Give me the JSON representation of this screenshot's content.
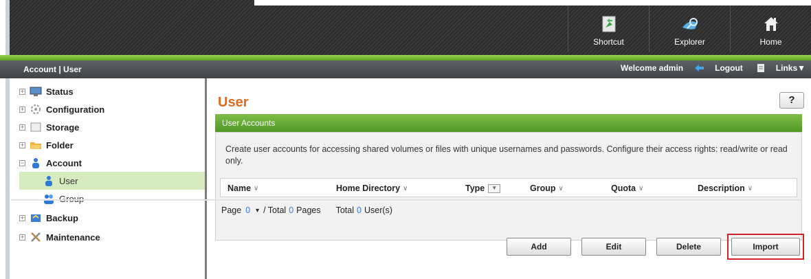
{
  "header": {
    "nav": [
      {
        "label": "Shortcut",
        "icon": "shortcut-icon"
      },
      {
        "label": "Explorer",
        "icon": "explorer-icon"
      },
      {
        "label": "Home",
        "icon": "home-icon"
      }
    ]
  },
  "subbar": {
    "breadcrumb": "Account | User",
    "welcome": "Welcome admin",
    "logout": "Logout",
    "links": "Links▼"
  },
  "sidebar": {
    "items": [
      {
        "label": "Status",
        "icon": "monitor-icon",
        "expander": "+"
      },
      {
        "label": "Configuration",
        "icon": "gear-icon",
        "expander": "+"
      },
      {
        "label": "Storage",
        "icon": "disk-icon",
        "expander": "+"
      },
      {
        "label": "Folder",
        "icon": "folder-icon",
        "expander": "+"
      },
      {
        "label": "Account",
        "icon": "account-icon",
        "expander": "−"
      },
      {
        "label": "User",
        "icon": "user-icon"
      },
      {
        "label": "Group",
        "icon": "group-icon"
      },
      {
        "label": "Backup",
        "icon": "backup-icon",
        "expander": "+"
      },
      {
        "label": "Maintenance",
        "icon": "tools-icon",
        "expander": "+"
      }
    ]
  },
  "main": {
    "title": "User",
    "help": "?",
    "panel_title": "User Accounts",
    "description": "Create user accounts for accessing shared volumes or files with unique usernames and passwords. Configure their access rights: read/write or read only.",
    "columns": [
      "Name",
      "Home Directory",
      "Type",
      "Group",
      "Quota",
      "Description"
    ],
    "pager": {
      "page_label": "Page",
      "page_value": "0",
      "total_label": "/ Total",
      "total_pages": "0",
      "pages_label": "Pages",
      "total_users_label": "Total",
      "total_users": "0",
      "users_label": "User(s)"
    },
    "buttons": {
      "add": "Add",
      "edit": "Edit",
      "delete": "Delete",
      "import": "Import"
    }
  },
  "colors": {
    "accent_green": "#5aa51e",
    "title_orange": "#e06a1f",
    "highlight_red": "#d3242a"
  }
}
